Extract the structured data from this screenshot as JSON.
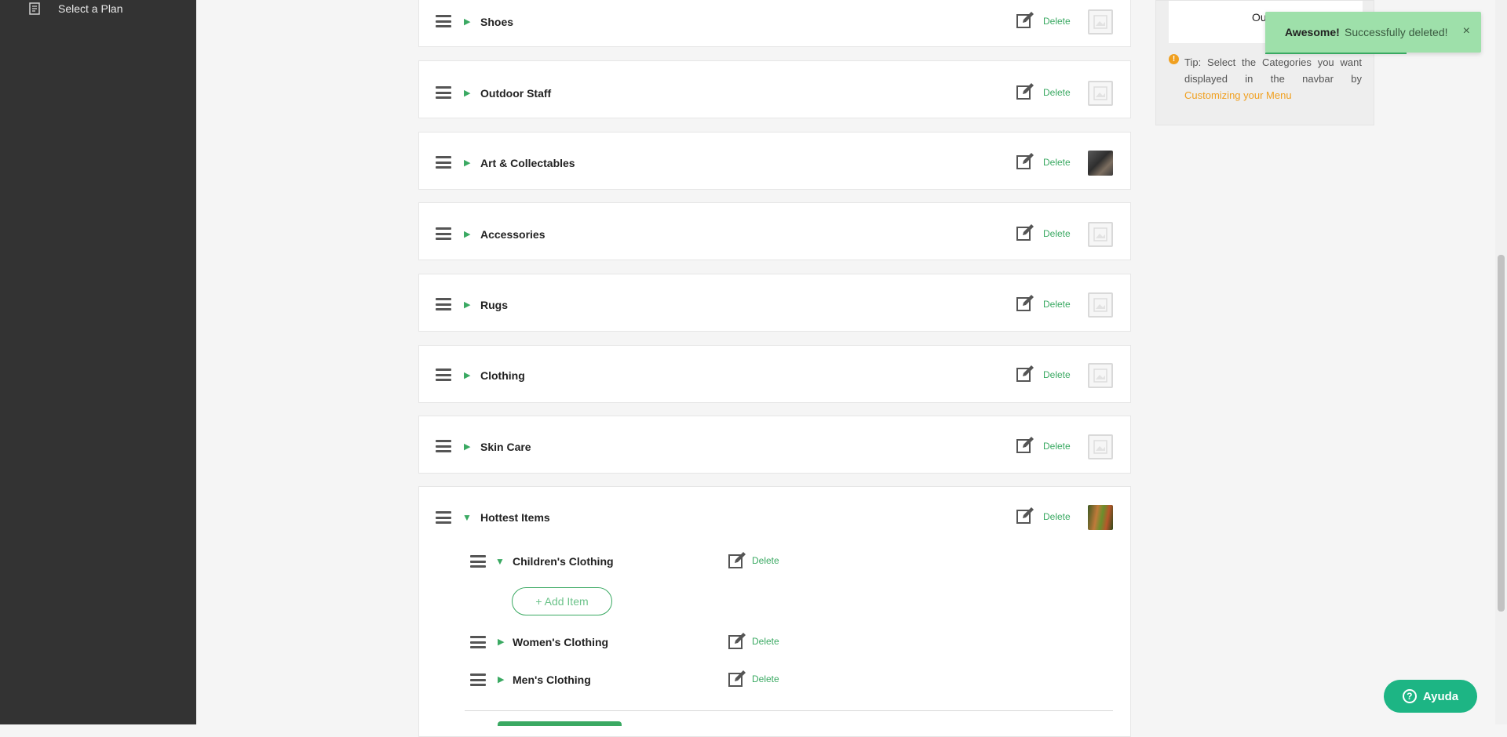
{
  "sidebar": {
    "item_label": "Select a Plan"
  },
  "categories": [
    {
      "name": "Shoes",
      "delete": "Delete",
      "thumb": "placeholder"
    },
    {
      "name": "Outdoor Staff",
      "delete": "Delete",
      "thumb": "placeholder"
    },
    {
      "name": "Art & Collectables",
      "delete": "Delete",
      "thumb": "photo"
    },
    {
      "name": "Accessories",
      "delete": "Delete",
      "thumb": "placeholder"
    },
    {
      "name": "Rugs",
      "delete": "Delete",
      "thumb": "placeholder"
    },
    {
      "name": "Clothing",
      "delete": "Delete",
      "thumb": "placeholder"
    },
    {
      "name": "Skin Care",
      "delete": "Delete",
      "thumb": "placeholder"
    },
    {
      "name": "Hottest Items",
      "delete": "Delete",
      "thumb": "photo",
      "expanded": true
    }
  ],
  "subcategories": [
    {
      "name": "Children's Clothing",
      "delete": "Delete",
      "expanded": true
    },
    {
      "name": "Women's Clothing",
      "delete": "Delete"
    },
    {
      "name": "Men's Clothing",
      "delete": "Delete"
    }
  ],
  "add_item_label": "+ Add Item",
  "right_panel": {
    "inner_text": "Outdoor",
    "tip_prefix": "Tip: Select the Categories you want displayed in the navbar by",
    "tip_link": "Customizing your Menu"
  },
  "toast": {
    "title": "Awesome!",
    "message": "Successfully deleted!",
    "close": "×"
  },
  "help_button": {
    "label": "Ayuda",
    "icon": "?"
  },
  "colors": {
    "accent": "#3aa962",
    "sidebar": "#333333",
    "help": "#1db584",
    "toast": "#9ee0aa"
  }
}
